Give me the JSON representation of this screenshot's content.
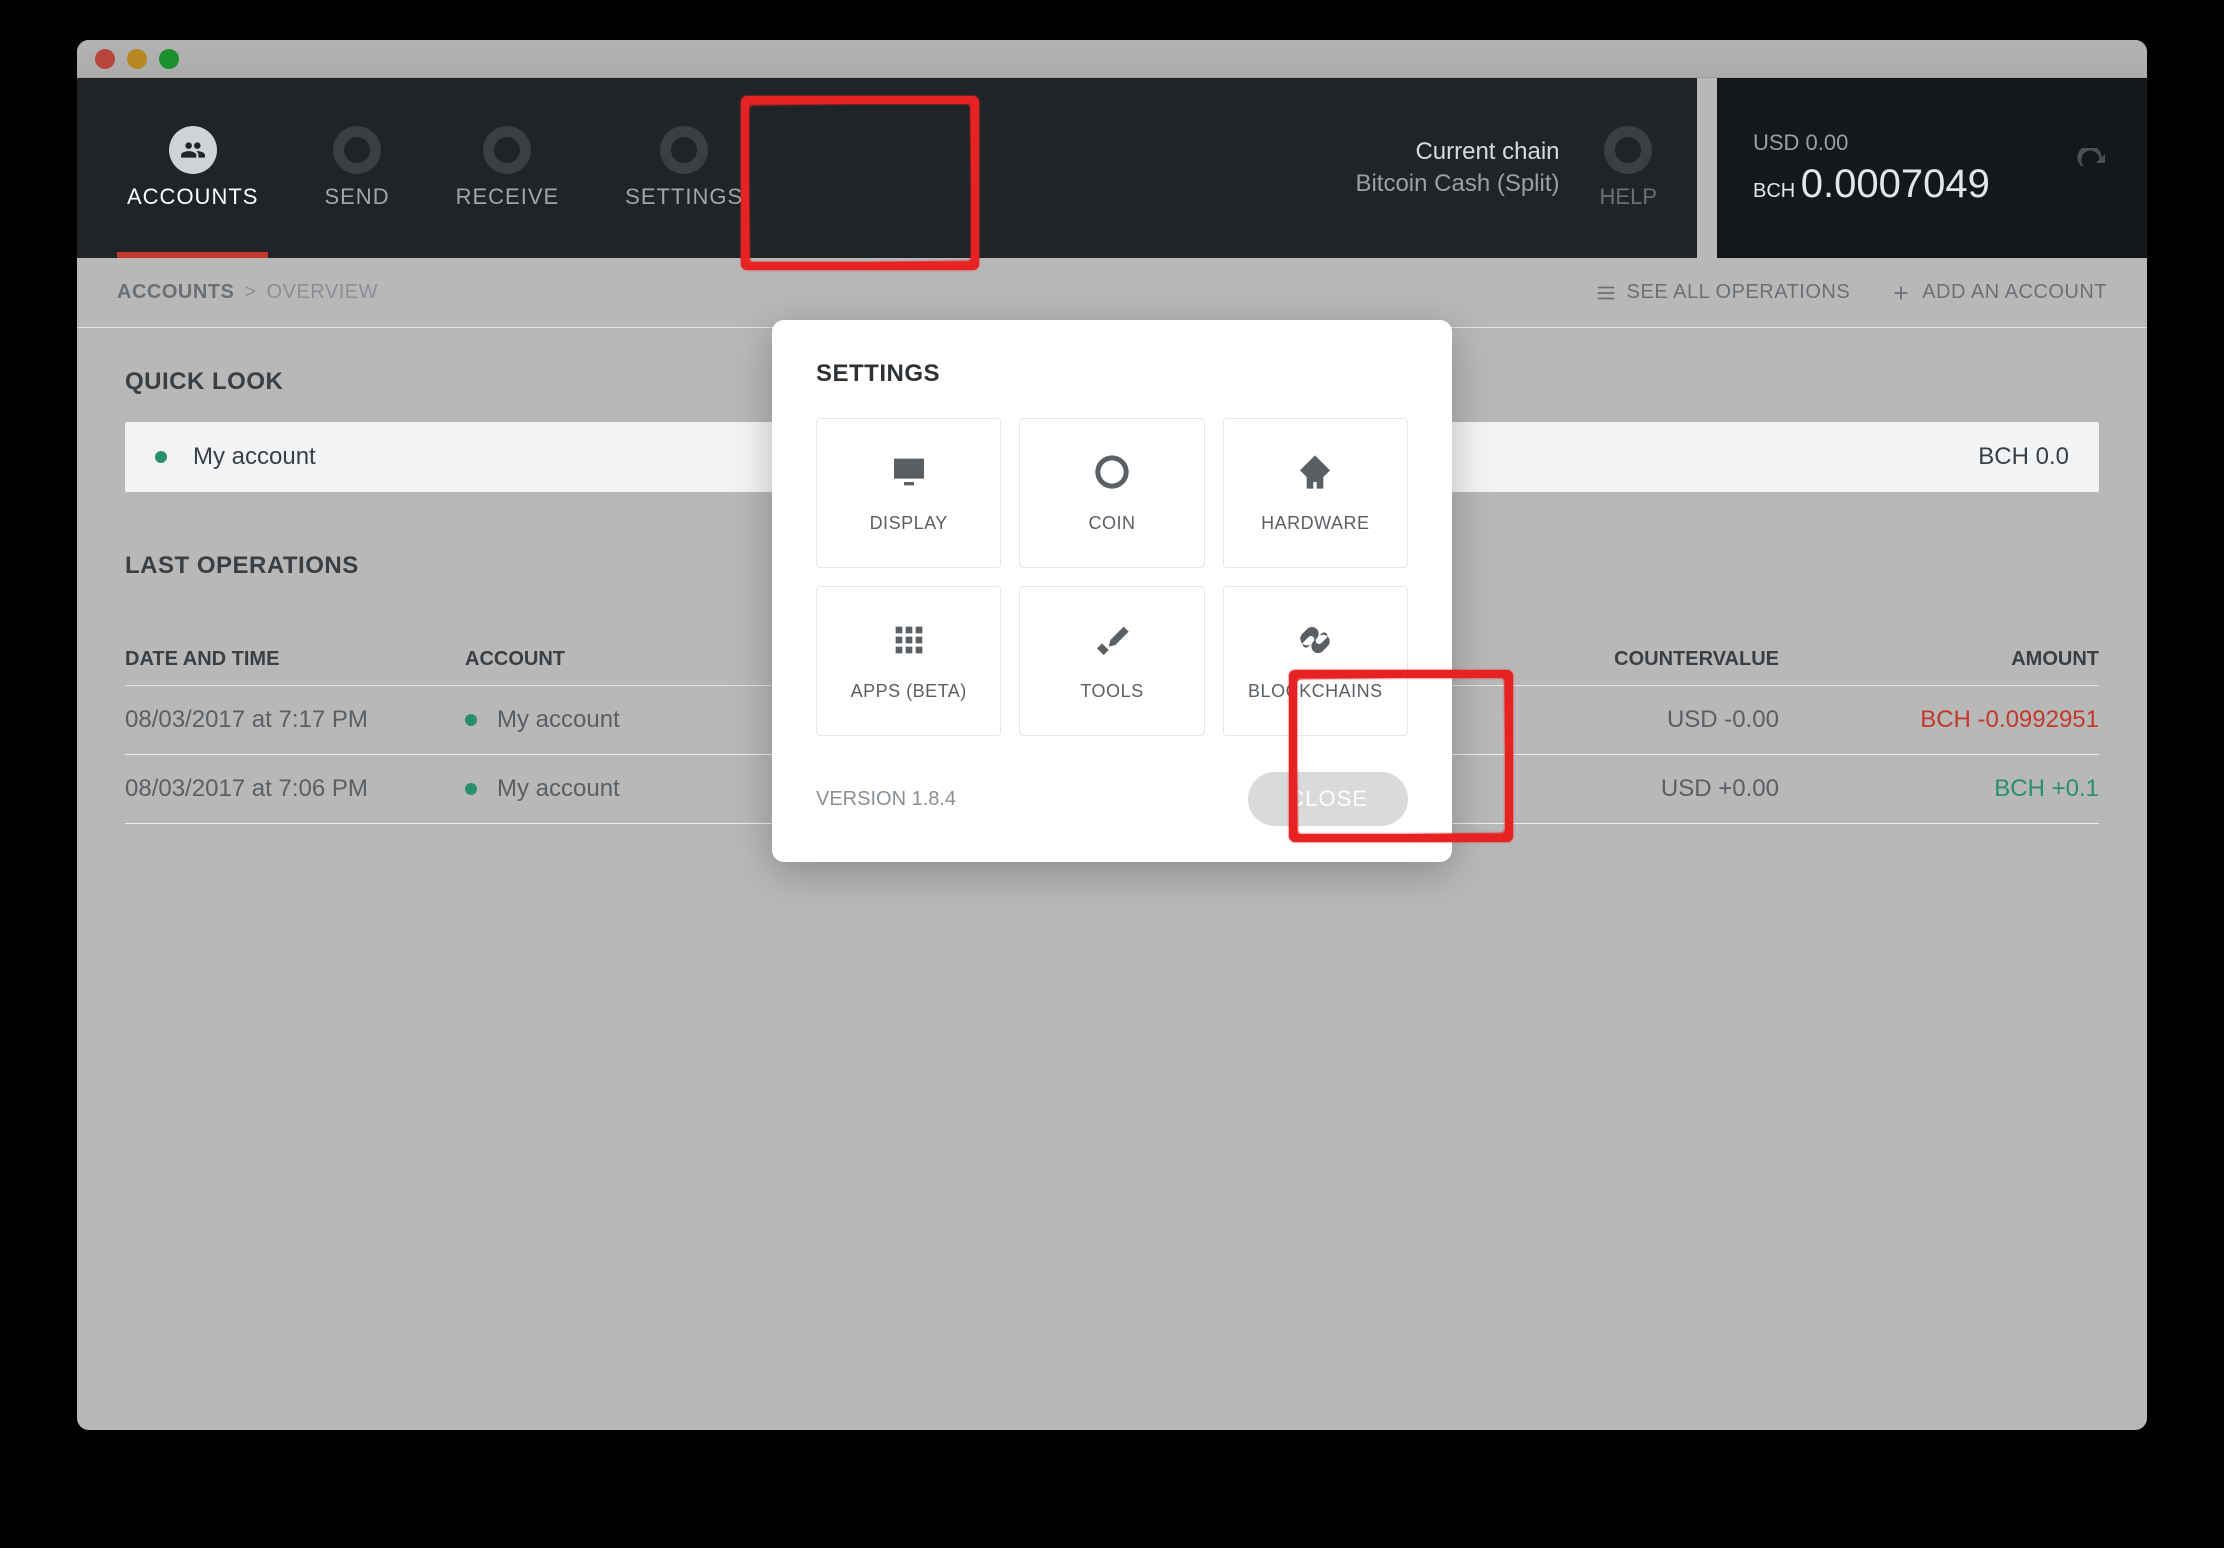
{
  "nav": {
    "items": [
      {
        "label": "ACCOUNTS"
      },
      {
        "label": "SEND"
      },
      {
        "label": "RECEIVE"
      },
      {
        "label": "SETTINGS"
      },
      {
        "label": "HELP"
      }
    ]
  },
  "chain": {
    "label": "Current chain",
    "value": "Bitcoin Cash (Split)"
  },
  "balance": {
    "usd": "USD 0.00",
    "crypto_ticker": "BCH",
    "crypto_amount": "0.0007049"
  },
  "breadcrumb": {
    "root": "ACCOUNTS",
    "sep": ">",
    "page": "OVERVIEW"
  },
  "actions": {
    "see_all": "SEE ALL OPERATIONS",
    "add_account": "ADD AN ACCOUNT"
  },
  "quick_look": {
    "title": "QUICK LOOK",
    "account_name": "My account",
    "balance": "BCH 0.0"
  },
  "ops": {
    "title": "LAST OPERATIONS",
    "columns": {
      "date": "DATE AND TIME",
      "account": "ACCOUNT",
      "cv": "COUNTERVALUE",
      "amount": "AMOUNT"
    },
    "rows": [
      {
        "date": "08/03/2017 at 7:17 PM",
        "account": "My account",
        "cv": "USD -0.00",
        "amount": "BCH -0.0992951",
        "sign": "neg"
      },
      {
        "date": "08/03/2017 at 7:06 PM",
        "account": "My account",
        "cv": "USD +0.00",
        "amount": "BCH +0.1",
        "sign": "pos"
      }
    ]
  },
  "modal": {
    "title": "SETTINGS",
    "tiles": [
      {
        "label": "DISPLAY"
      },
      {
        "label": "COIN"
      },
      {
        "label": "HARDWARE"
      },
      {
        "label": "APPS (BETA)"
      },
      {
        "label": "TOOLS"
      },
      {
        "label": "BLOCKCHAINS"
      }
    ],
    "version": "VERSION 1.8.4",
    "close": "CLOSE"
  }
}
